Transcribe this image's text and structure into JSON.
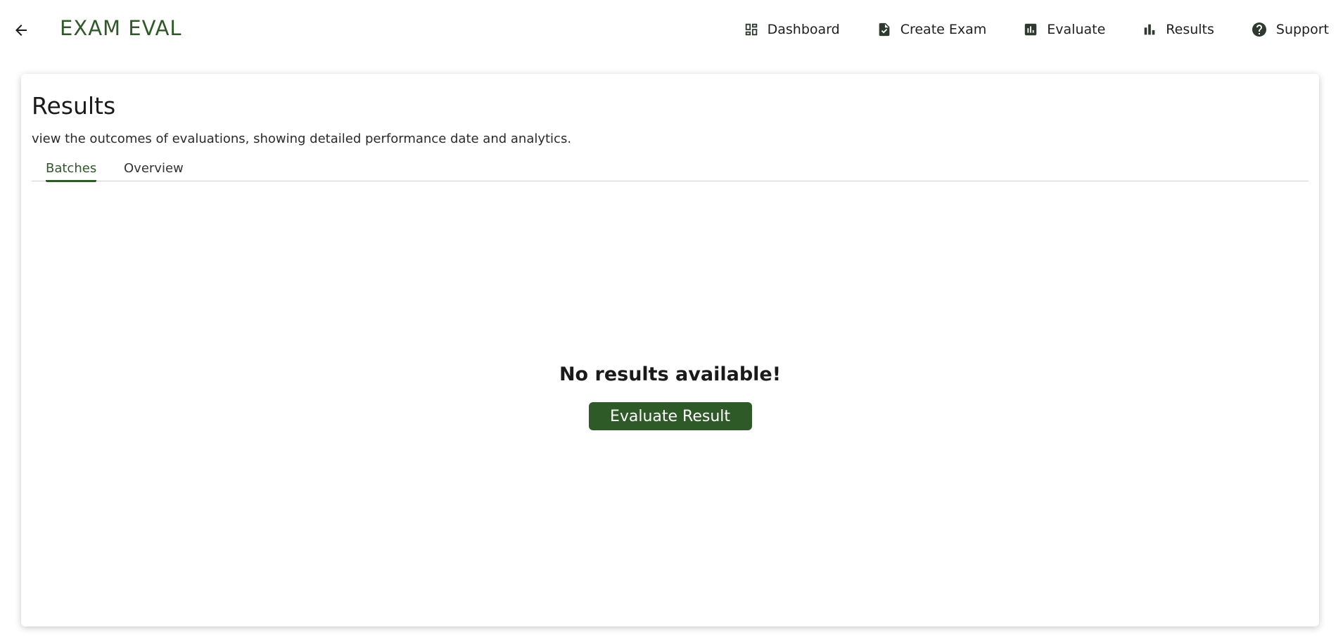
{
  "header": {
    "back_icon": "arrow-left-icon",
    "brand": "EXAM EVAL",
    "nav": [
      {
        "label": "Dashboard",
        "icon": "dashboard-icon"
      },
      {
        "label": "Create Exam",
        "icon": "document-check-icon"
      },
      {
        "label": "Evaluate",
        "icon": "report-chart-icon"
      },
      {
        "label": "Results",
        "icon": "bar-chart-icon"
      },
      {
        "label": "Support",
        "icon": "help-circle-icon"
      }
    ]
  },
  "main": {
    "title": "Results",
    "description": "view the outcomes of evaluations, showing detailed performance date and analytics.",
    "tabs": [
      {
        "label": "Batches",
        "active": true
      },
      {
        "label": "Overview",
        "active": false
      }
    ],
    "empty_state": {
      "message": "No results available!",
      "button_label": "Evaluate Result"
    }
  },
  "colors": {
    "accent": "#2e5a27",
    "text": "#1a1a1a",
    "divider": "#cfcfcf"
  }
}
